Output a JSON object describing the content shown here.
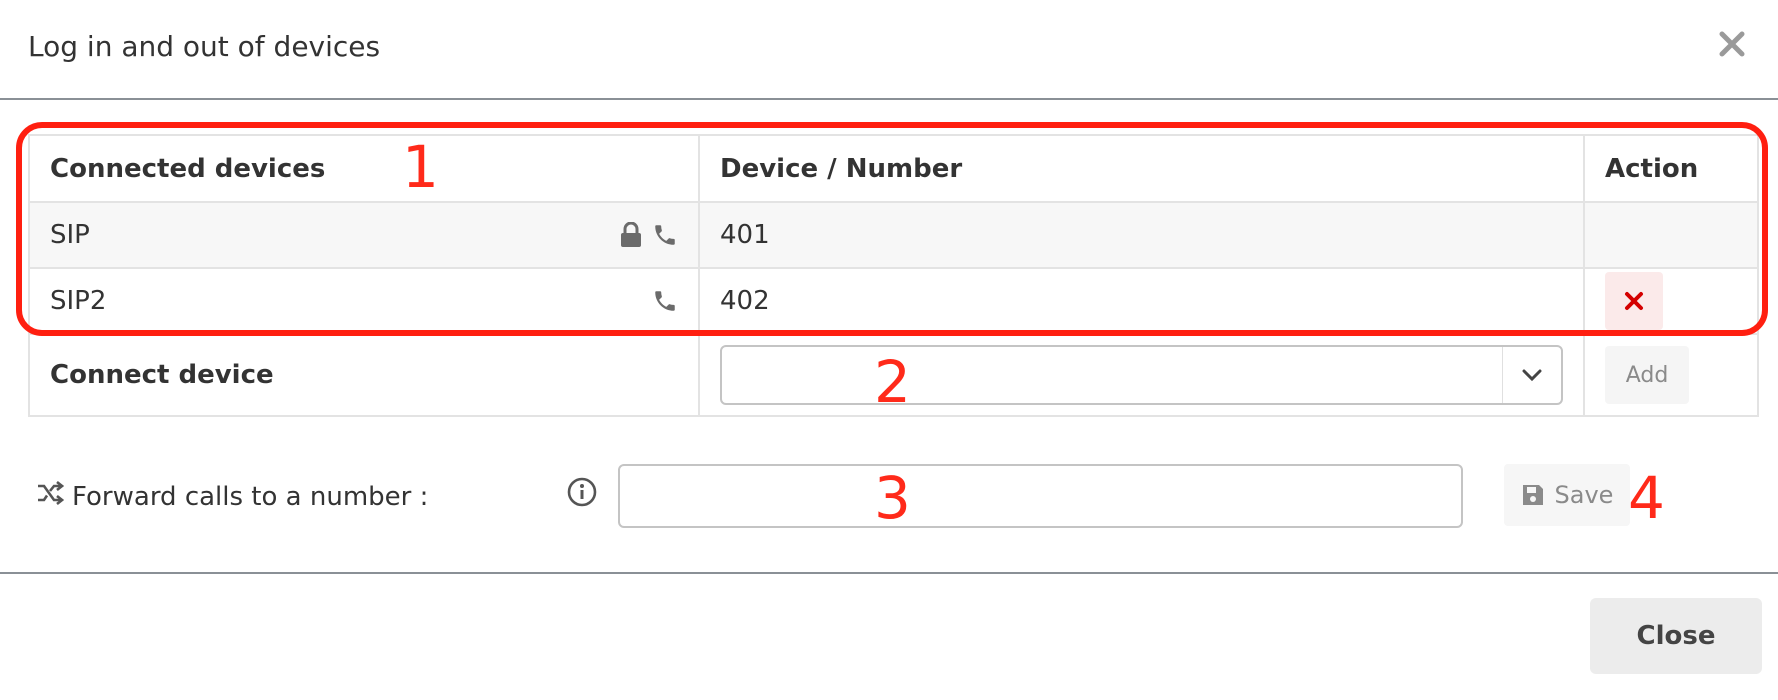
{
  "dialog": {
    "title": "Log in and out of devices",
    "close_icon": "close-icon"
  },
  "table": {
    "headers": [
      "Connected devices",
      "Device / Number",
      "Action"
    ],
    "rows": [
      {
        "device": "SIP",
        "icons": [
          "lock-icon",
          "phone-icon"
        ],
        "number": "401",
        "action": ""
      },
      {
        "device": "SIP2",
        "icons": [
          "phone-icon"
        ],
        "number": "402",
        "action": "remove-icon"
      }
    ],
    "connect": {
      "label": "Connect device",
      "select_value": "",
      "add_label": "Add"
    }
  },
  "forward": {
    "label": "Forward calls to a number :",
    "input_value": "",
    "save_label": "Save"
  },
  "footer": {
    "close_label": "Close"
  },
  "annotations": [
    "1",
    "2",
    "3",
    "4"
  ],
  "colors": {
    "annotation": "#ff2a1a",
    "remove": "#d40000",
    "border": "#e3e3e3"
  }
}
